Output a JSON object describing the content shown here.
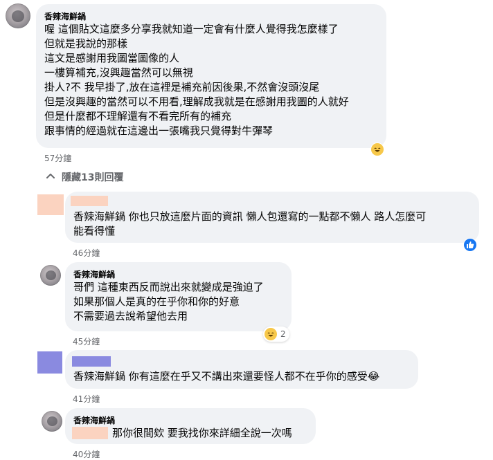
{
  "comments": [
    {
      "author": "香辣海鮮鍋",
      "lines": [
        "喔 這個貼文這麼多分享我就知道一定會有什麼人覺得我怎麼樣了",
        "但就是我說的那樣",
        "這文是感謝用我圖當圖像的人",
        "一樓算補充,沒興趣當然可以無視",
        "掛人?不 我早掛了,放在這裡是補充前因後果,不然會沒頭沒尾",
        "但是沒興趣的當然可以不用看,理解成我就是在感謝用我圖的人就好",
        "但是什麼都不理解還有不看完所有的補充",
        "跟事情的經過就在這邊出一張嘴我只覺得對牛彈琴"
      ],
      "time": "57分鐘",
      "reaction": "haha"
    }
  ],
  "hide_replies": {
    "label": "隱藏13則回覆",
    "icon": "chevron-up-icon"
  },
  "replies": [
    {
      "author_masked": true,
      "mask_color": "#fbd3c0",
      "lines": [
        "香辣海鮮鍋 你也只放這麼片面的資訊 懶人包還寫的一點都不懶人 路人怎麼可",
        "能看得懂"
      ],
      "time": "46分鐘",
      "reaction": "like"
    },
    {
      "author": "香辣海鮮鍋",
      "lines": [
        "哥們 這種東西反而說出來就變成是強迫了",
        "如果那個人是真的在乎你和你的好意",
        "不需要過去說希望他去用"
      ],
      "time": "45分鐘",
      "reaction": "haha",
      "reaction_count": "2"
    },
    {
      "author_masked": true,
      "mask_color": "#8a8ae0",
      "lines": [
        "香辣海鮮鍋 你有這麼在乎又不講出來還要怪人都不在乎你的感受😂"
      ],
      "time": "41分鐘"
    },
    {
      "author": "香辣海鮮鍋",
      "lines": [
        "那你很間欸 要我找你來詳細全說一次嗎"
      ],
      "time": "40分鐘",
      "mention_masked": true,
      "mask_color": "#fbd3c0"
    }
  ],
  "colors": {
    "bubble": "#f0f2f5",
    "meta_text": "#65676b",
    "like_blue": "#1877f2",
    "haha_yellow": "#f7c84a"
  }
}
